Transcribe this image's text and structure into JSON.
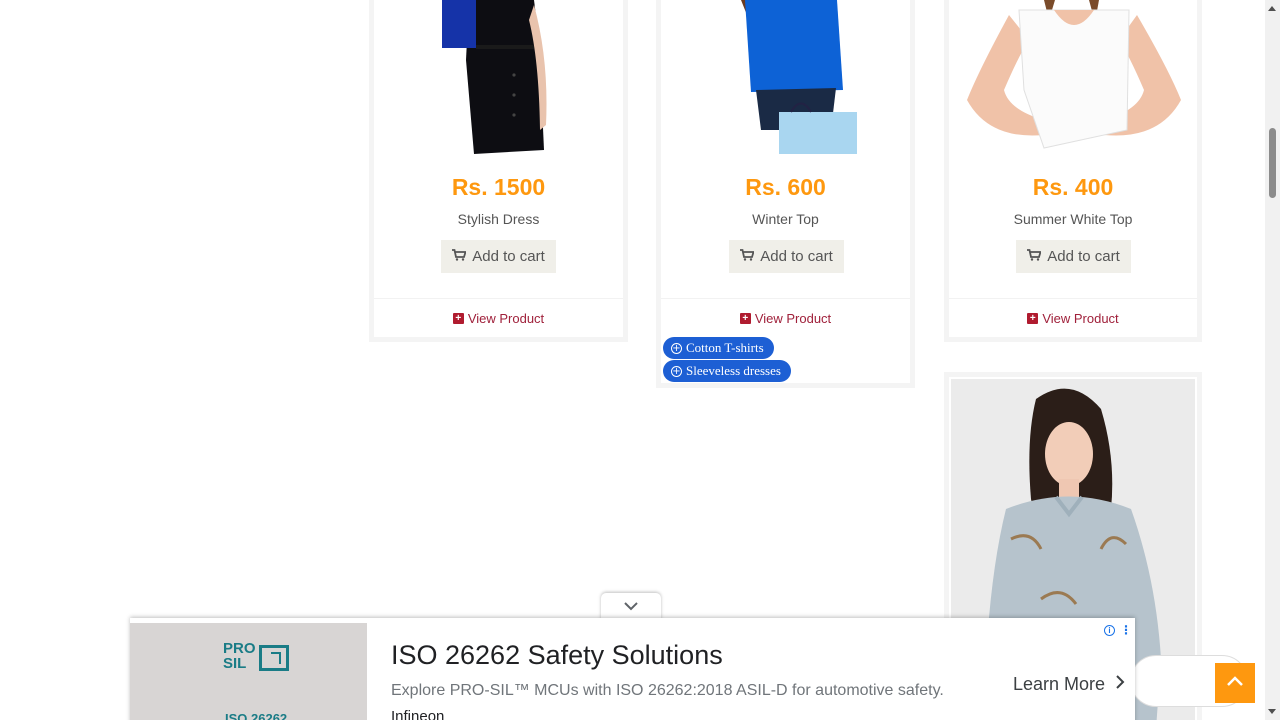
{
  "products": [
    {
      "price": "Rs. 1500",
      "name": "Stylish Dress",
      "add_to_cart": "Add to cart",
      "view_product": "View Product"
    },
    {
      "price": "Rs. 600",
      "name": "Winter Top",
      "add_to_cart": "Add to cart",
      "view_product": "View Product"
    },
    {
      "price": "Rs. 400",
      "name": "Summer White Top",
      "add_to_cart": "Add to cart",
      "view_product": "View Product"
    }
  ],
  "tags": [
    "Cotton T-shirts",
    "Sleeveless dresses"
  ],
  "ad": {
    "logo_line1": "PRO",
    "logo_line2": "SIL",
    "image_caption": "ISO 26262",
    "title": "ISO 26262 Safety Solutions",
    "description": "Explore PRO-SIL™ MCUs with ISO 26262:2018 ASIL-D for automotive safety.",
    "advertiser": "Infineon",
    "cta": "Learn More"
  },
  "colors": {
    "price": "#fe980f",
    "view_link": "#a0213b",
    "tag_bg": "#1d5fd4",
    "scroll_top_bg": "#fe980f",
    "brand_teal": "#1a7c86"
  }
}
